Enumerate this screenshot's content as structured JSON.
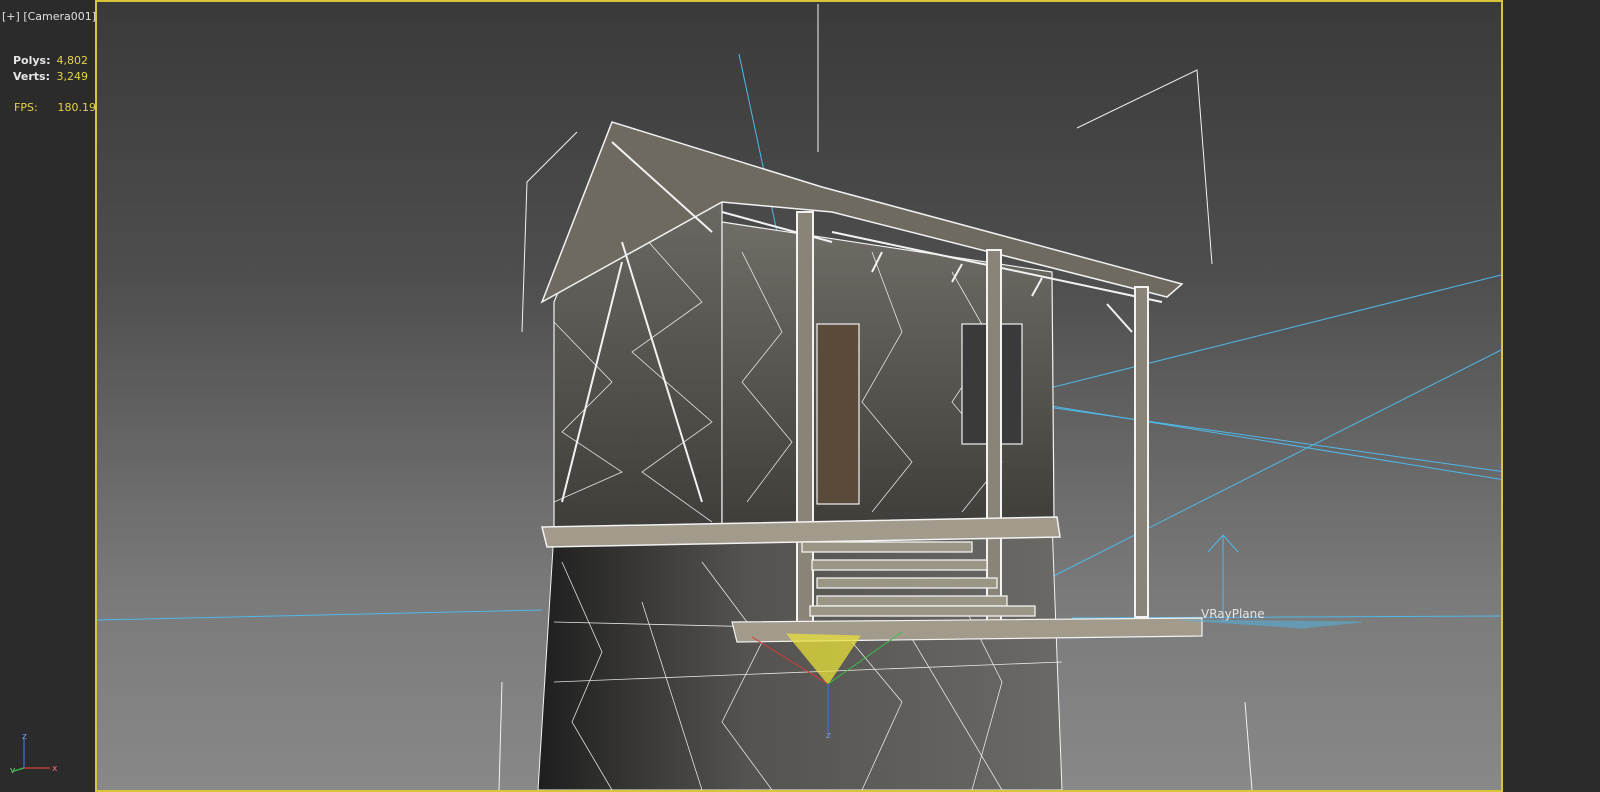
{
  "viewport": {
    "label_plus": "[+]",
    "label_camera": "[Camera001]",
    "border_color": "#d8c53a"
  },
  "stats": {
    "polys_label": "Polys:",
    "polys_value": "4,802",
    "verts_label": "Verts:",
    "verts_value": "3,249",
    "fps_label": "FPS:",
    "fps_value": "180.190"
  },
  "scene": {
    "vray_plane_label": "VRayPlane",
    "gizmo_label": "z"
  },
  "axis_gizmo": {
    "z_label": "z",
    "x_label": "x",
    "y_label": "y"
  },
  "colors": {
    "stat_value": "#e3d24a",
    "light_lines": "#4fb8e8",
    "wire": "#f2f2f2",
    "selection_gizmo": "#e8e03a"
  }
}
